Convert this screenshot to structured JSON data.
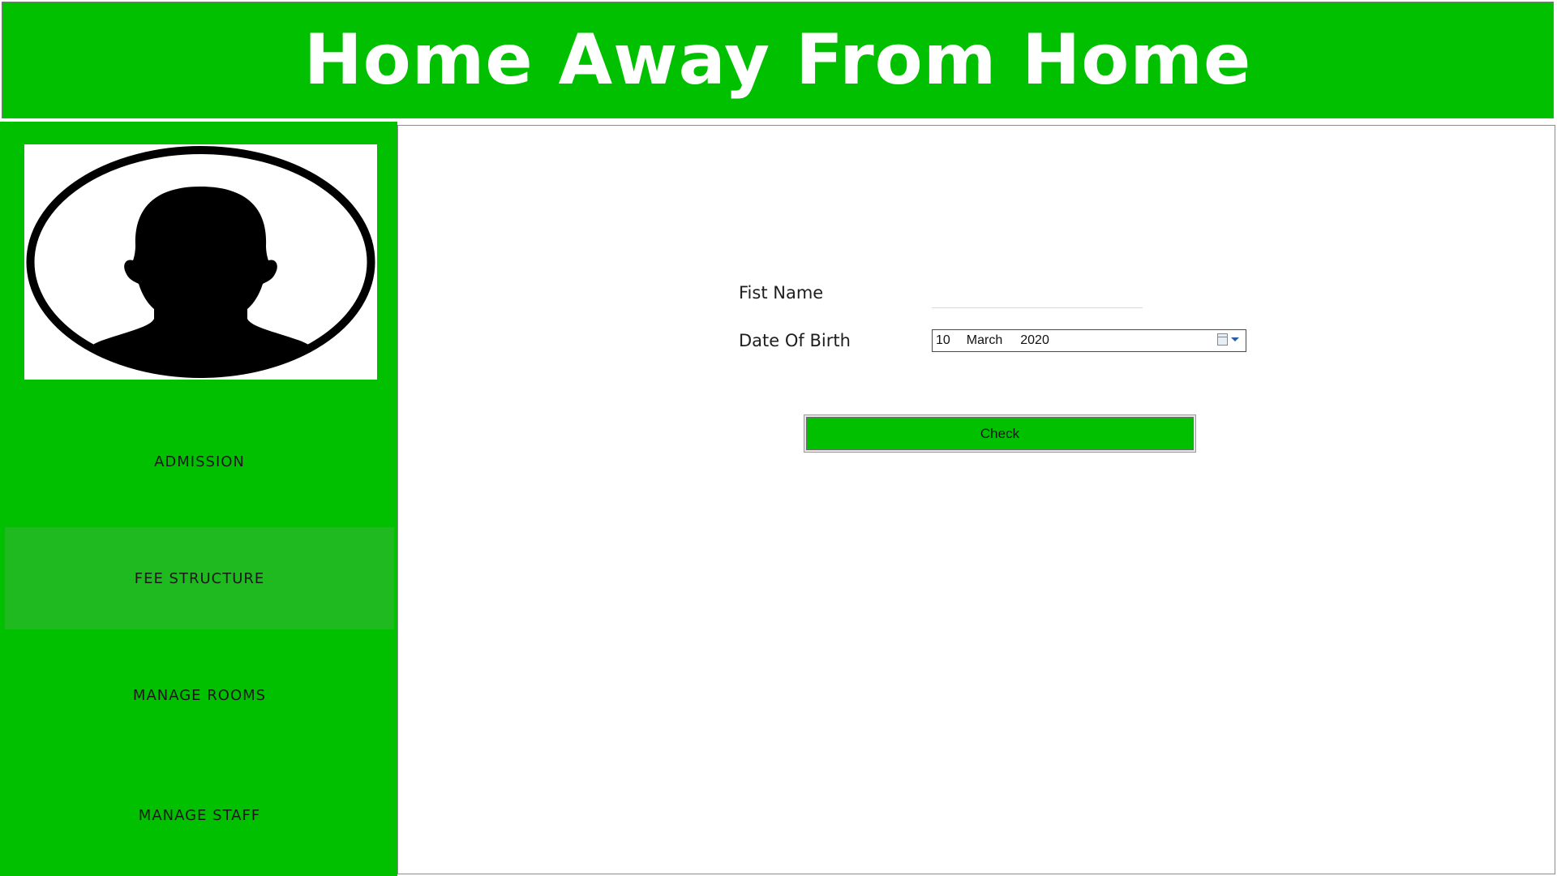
{
  "header": {
    "title": "Home Away From Home"
  },
  "sidebar": {
    "avatar_icon": "user-silhouette-icon",
    "items": [
      {
        "label": "ADMISSION",
        "active": false
      },
      {
        "label": "FEE STRUCTURE",
        "active": true
      },
      {
        "label": "MANAGE ROOMS",
        "active": false
      },
      {
        "label": "MANAGE STAFF",
        "active": false
      }
    ]
  },
  "form": {
    "first_name_label": "Fist Name",
    "first_name_value": "",
    "dob_label": "Date Of Birth",
    "dob": {
      "day": "10",
      "month": "March",
      "year": "2020"
    },
    "check_label": "Check"
  },
  "colors": {
    "brand_green": "#00c000",
    "active_nav": "#1fba1f",
    "title_text": "#ffffff"
  }
}
